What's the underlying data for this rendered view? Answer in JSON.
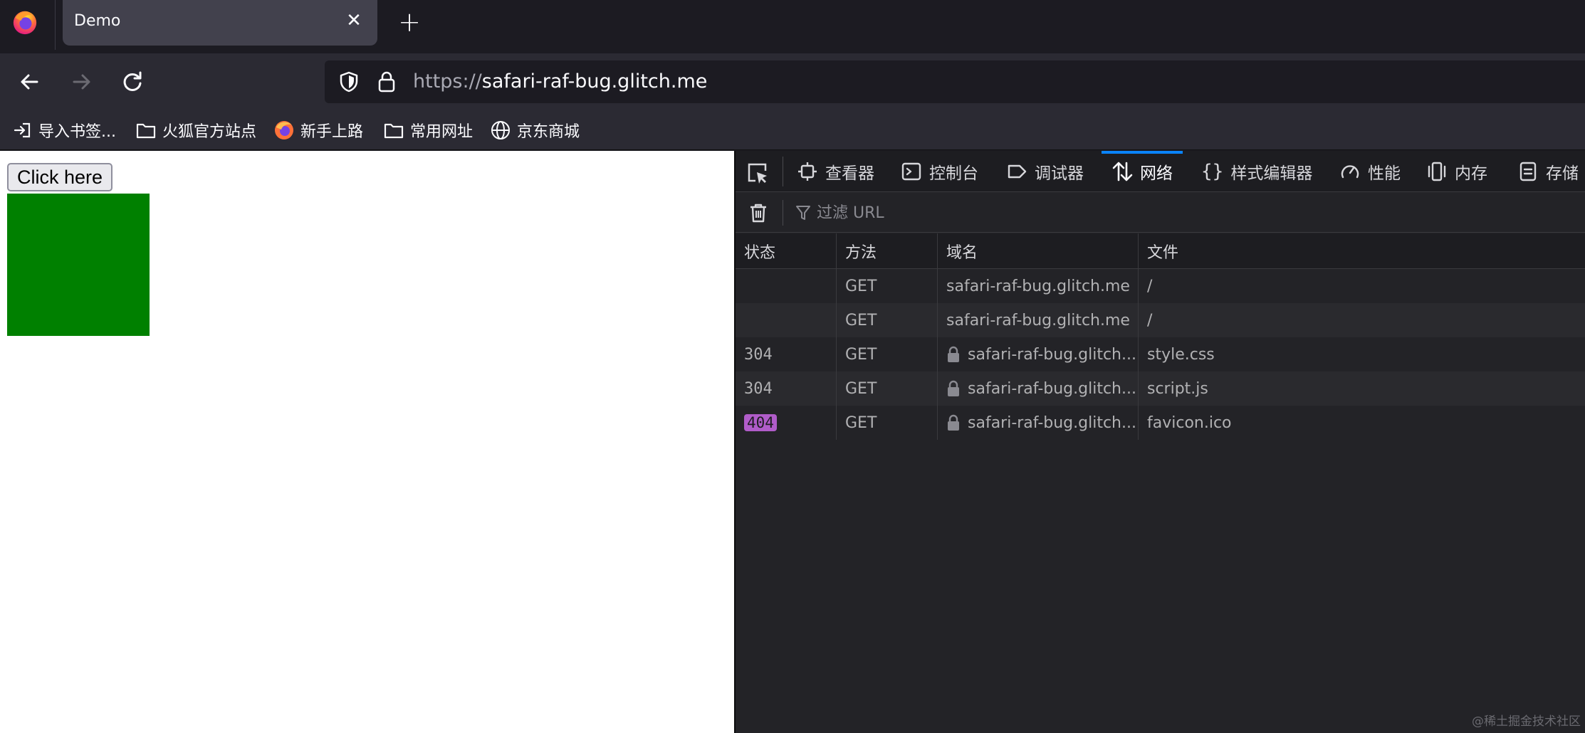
{
  "browser": {
    "tab_title": "Demo",
    "url_scheme": "https://",
    "url_host": "safari-raf-bug.glitch.me",
    "bookmarks": [
      {
        "label": "导入书签...",
        "icon": "import-icon"
      },
      {
        "label": "火狐官方站点",
        "icon": "folder-icon"
      },
      {
        "label": "新手上路",
        "icon": "firefox-icon"
      },
      {
        "label": "常用网址",
        "icon": "folder-icon"
      },
      {
        "label": "京东商城",
        "icon": "globe-icon"
      }
    ]
  },
  "page": {
    "button_label": "Click here",
    "box_color": "#008000"
  },
  "devtools": {
    "tabs": [
      {
        "label": "查看器",
        "icon": "inspector-icon"
      },
      {
        "label": "控制台",
        "icon": "console-icon"
      },
      {
        "label": "调试器",
        "icon": "debugger-icon"
      },
      {
        "label": "网络",
        "icon": "network-icon",
        "active": true
      },
      {
        "label": "样式编辑器",
        "icon": "style-editor-icon"
      },
      {
        "label": "性能",
        "icon": "performance-icon"
      },
      {
        "label": "内存",
        "icon": "memory-icon"
      },
      {
        "label": "存储",
        "icon": "storage-icon"
      }
    ],
    "filter_placeholder": "过滤 URL",
    "columns": {
      "status": "状态",
      "method": "方法",
      "domain": "域名",
      "file": "文件"
    },
    "requests": [
      {
        "status": "",
        "method": "GET",
        "domain": "safari-raf-bug.glitch.me",
        "secure": false,
        "file": "/"
      },
      {
        "status": "",
        "method": "GET",
        "domain": "safari-raf-bug.glitch.me",
        "secure": false,
        "file": "/"
      },
      {
        "status": "304",
        "method": "GET",
        "domain": "safari-raf-bug.glitch...",
        "secure": true,
        "file": "style.css"
      },
      {
        "status": "304",
        "method": "GET",
        "domain": "safari-raf-bug.glitch...",
        "secure": true,
        "file": "script.js"
      },
      {
        "status": "404",
        "method": "GET",
        "domain": "safari-raf-bug.glitch...",
        "secure": true,
        "file": "favicon.ico"
      }
    ]
  },
  "watermark": "@稀土掘金技术社区"
}
